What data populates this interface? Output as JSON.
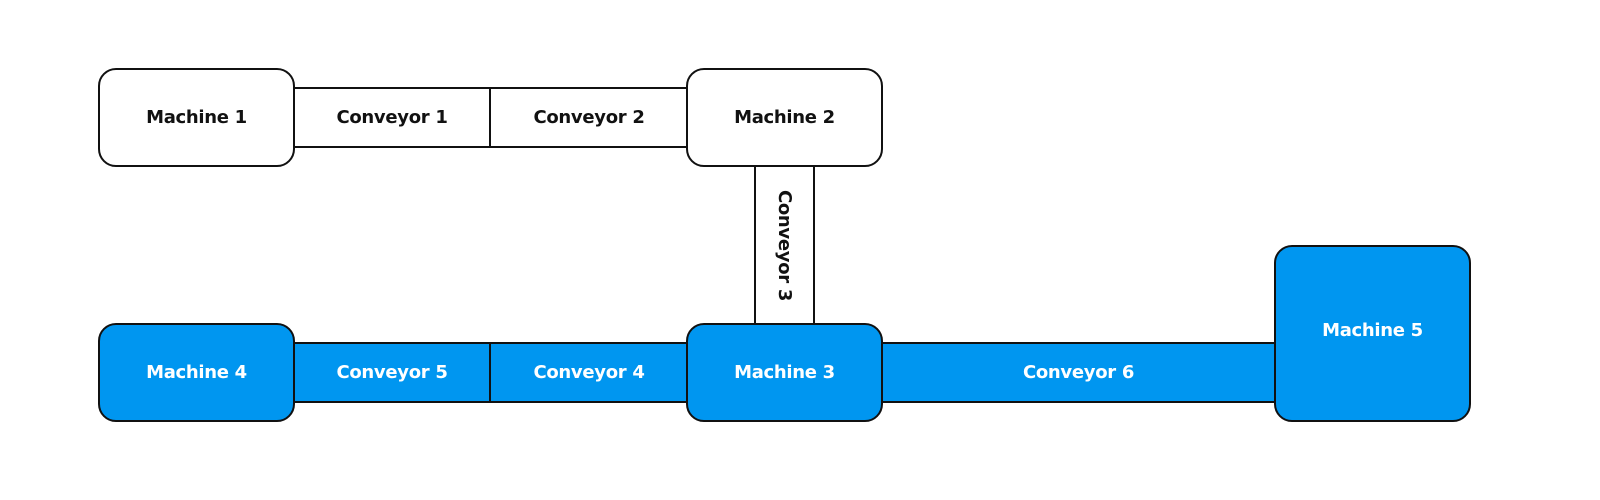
{
  "colors": {
    "active": "#0096f0",
    "inactive": "#ffffff",
    "stroke": "#111111"
  },
  "nodes": {
    "machine1": {
      "label": "Machine 1",
      "state": "inactive"
    },
    "machine2": {
      "label": "Machine 2",
      "state": "inactive"
    },
    "machine3": {
      "label": "Machine 3",
      "state": "active"
    },
    "machine4": {
      "label": "Machine 4",
      "state": "active"
    },
    "machine5": {
      "label": "Machine 5",
      "state": "active"
    },
    "conveyor1": {
      "label": "Conveyor 1",
      "state": "inactive",
      "from": "Machine 1",
      "to": "Machine 2"
    },
    "conveyor2": {
      "label": "Conveyor 2",
      "state": "inactive",
      "from": "Machine 1",
      "to": "Machine 2"
    },
    "conveyor3": {
      "label": "Conveyor 3",
      "state": "inactive",
      "from": "Machine 2",
      "to": "Machine 3"
    },
    "conveyor4": {
      "label": "Conveyor 4",
      "state": "active",
      "from": "Machine 3",
      "to": "Machine 4"
    },
    "conveyor5": {
      "label": "Conveyor 5",
      "state": "active",
      "from": "Machine 3",
      "to": "Machine 4"
    },
    "conveyor6": {
      "label": "Conveyor 6",
      "state": "active",
      "from": "Machine 3",
      "to": "Machine 5"
    }
  }
}
